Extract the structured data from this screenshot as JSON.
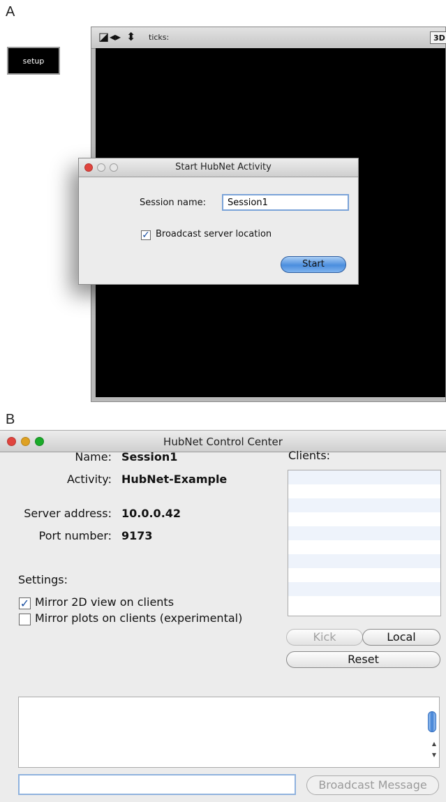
{
  "panel_a": {
    "label": "A",
    "setup_button": "setup",
    "world": {
      "ticks_label": "ticks:",
      "view_3d_label": "3D",
      "icons": [
        "color-flag-icon",
        "left-right-arrows-icon",
        "up-down-arrows-icon"
      ]
    },
    "dialog": {
      "title": "Start HubNet Activity",
      "session_name_label": "Session name:",
      "session_name_value": "Session1",
      "broadcast_label": "Broadcast server location",
      "broadcast_checked": true,
      "start_label": "Start"
    }
  },
  "panel_b": {
    "label": "B",
    "title": "HubNet Control Center",
    "fields": {
      "name_label": "Name:",
      "name_value": "Session1",
      "activity_label": "Activity:",
      "activity_value": "HubNet-Example",
      "server_label": "Server address:",
      "server_value": "10.0.0.42",
      "port_label": "Port number:",
      "port_value": "9173"
    },
    "settings_label": "Settings:",
    "mirror_2d_label": "Mirror 2D view on clients",
    "mirror_2d_checked": true,
    "mirror_plots_label": "Mirror plots on clients (experimental)",
    "mirror_plots_checked": false,
    "clients_label": "Clients:",
    "kick_label": "Kick",
    "local_label": "Local",
    "reset_label": "Reset",
    "broadcast_button": "Broadcast Message",
    "message_value": ""
  },
  "colors": {
    "traffic_red": "#e0443e",
    "traffic_yellow": "#dea123",
    "traffic_green": "#1aab29",
    "accent_blue": "#4b8ede"
  }
}
